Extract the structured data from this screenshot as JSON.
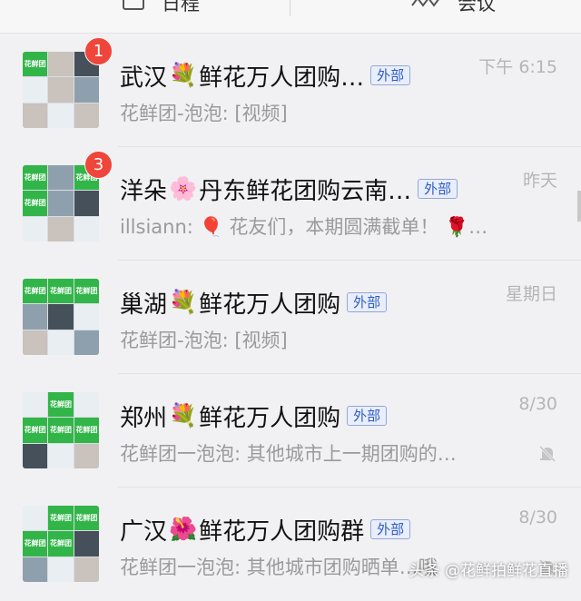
{
  "tabs": [
    {
      "label": "日程",
      "icon": "calendar-icon"
    },
    {
      "label": "会议",
      "icon": "meeting-icon"
    }
  ],
  "chats": [
    {
      "title": "武汉",
      "emoji": "💐",
      "title_rest": "鲜花万人团购…",
      "external": "外部",
      "time": "下午 6:15",
      "preview": "花鲜团-泡泡: [视频]",
      "badge": "1",
      "muted": false
    },
    {
      "title": "洋朵",
      "emoji": "🌸",
      "title_rest": "丹东鲜花团购云南…",
      "external": "外部",
      "time": "昨天",
      "preview": "illsiann: 🎈 花友们，本期圆满截单！ 🌹…",
      "badge": "3",
      "muted": false
    },
    {
      "title": "巢湖",
      "emoji": "💐",
      "title_rest": "鲜花万人团购",
      "external": "外部",
      "time": "星期日",
      "preview": "花鲜团-泡泡: [视频]",
      "badge": "",
      "muted": false
    },
    {
      "title": "郑州",
      "emoji": "💐",
      "title_rest": "鲜花万人团购",
      "external": "外部",
      "time": "8/30",
      "preview": "花鲜团一泡泡: 其他城市上一期团购的…",
      "badge": "",
      "muted": true
    },
    {
      "title": "广汉",
      "emoji": "🌺",
      "title_rest": "鲜花万人团购群",
      "external": "外部",
      "time": "8/30",
      "preview": "花鲜团一泡泡: 其他城市团购晒单…哦",
      "badge": "",
      "muted": true
    }
  ],
  "avatar_label": "花鲜团",
  "watermark": "头条 @花鲜拍鲜花直播"
}
